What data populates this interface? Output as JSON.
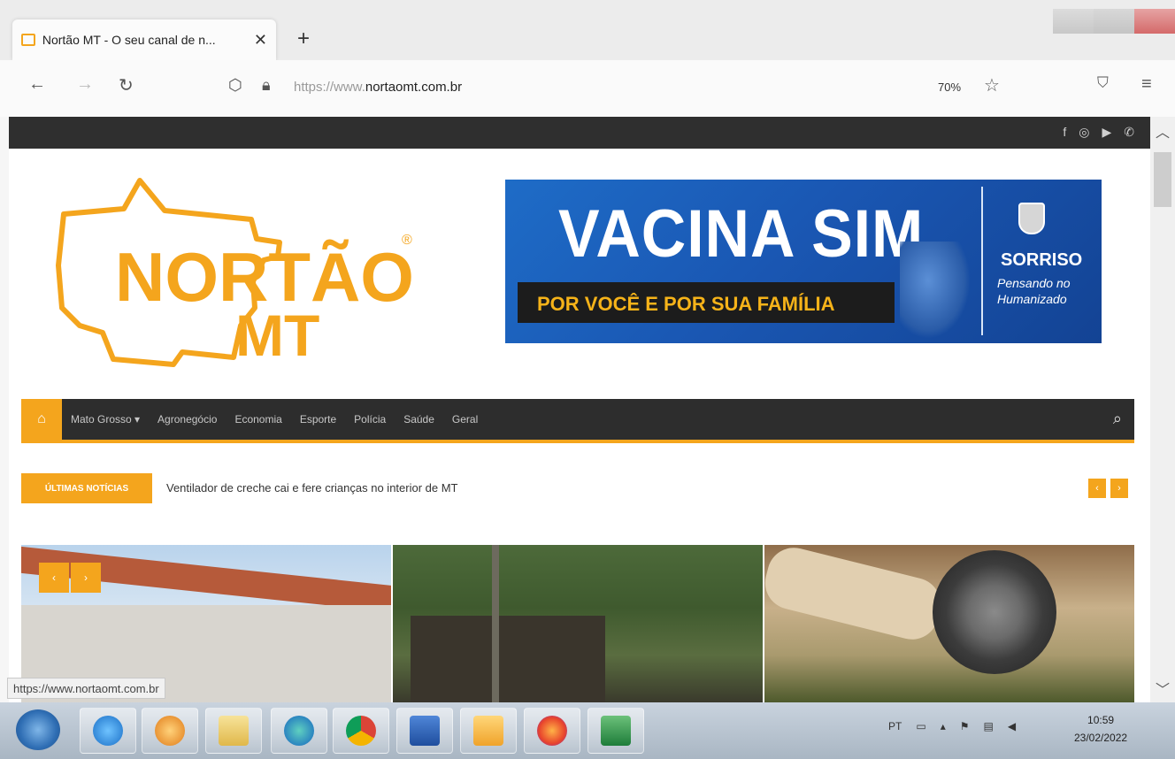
{
  "browser": {
    "tab_title": "Nortão MT - O seu canal de n...",
    "tab_close": "✕",
    "new_tab": "+",
    "url_prefix": "https://www.",
    "url_domain": "nortaomt.com.br",
    "zoom": "70%",
    "status_url": "https://www.nortaomt.com.br"
  },
  "site": {
    "logo_text_1": "NORTÃO",
    "logo_text_2": "MT",
    "logo_registered": "®",
    "banner": {
      "title": "VACINA SIM",
      "subtitle": "POR VOCÊ E POR SUA FAMÍLIA",
      "city": "SORRISO",
      "tagline": "Pensando no Humanizado"
    },
    "nav": {
      "items": [
        "Mato Grosso ▾",
        "Agronegócio",
        "Economia",
        "Esporte",
        "Polícia",
        "Saúde",
        "Geral"
      ]
    },
    "ticker": {
      "label": "ÚLTIMAS NOTÍCIAS",
      "text": "Ventilador de creche cai e fere crianças no interior de MT",
      "prev": "‹",
      "next": "›"
    },
    "slider_prev": "‹",
    "slider_next": "›"
  },
  "taskbar": {
    "tray_lang": "PT",
    "time": "10:59",
    "date": "23/02/2022"
  },
  "colors": {
    "accent": "#f4a51d",
    "nav_bg": "#2d2d2d",
    "topbar_bg": "#2f2f2f"
  }
}
